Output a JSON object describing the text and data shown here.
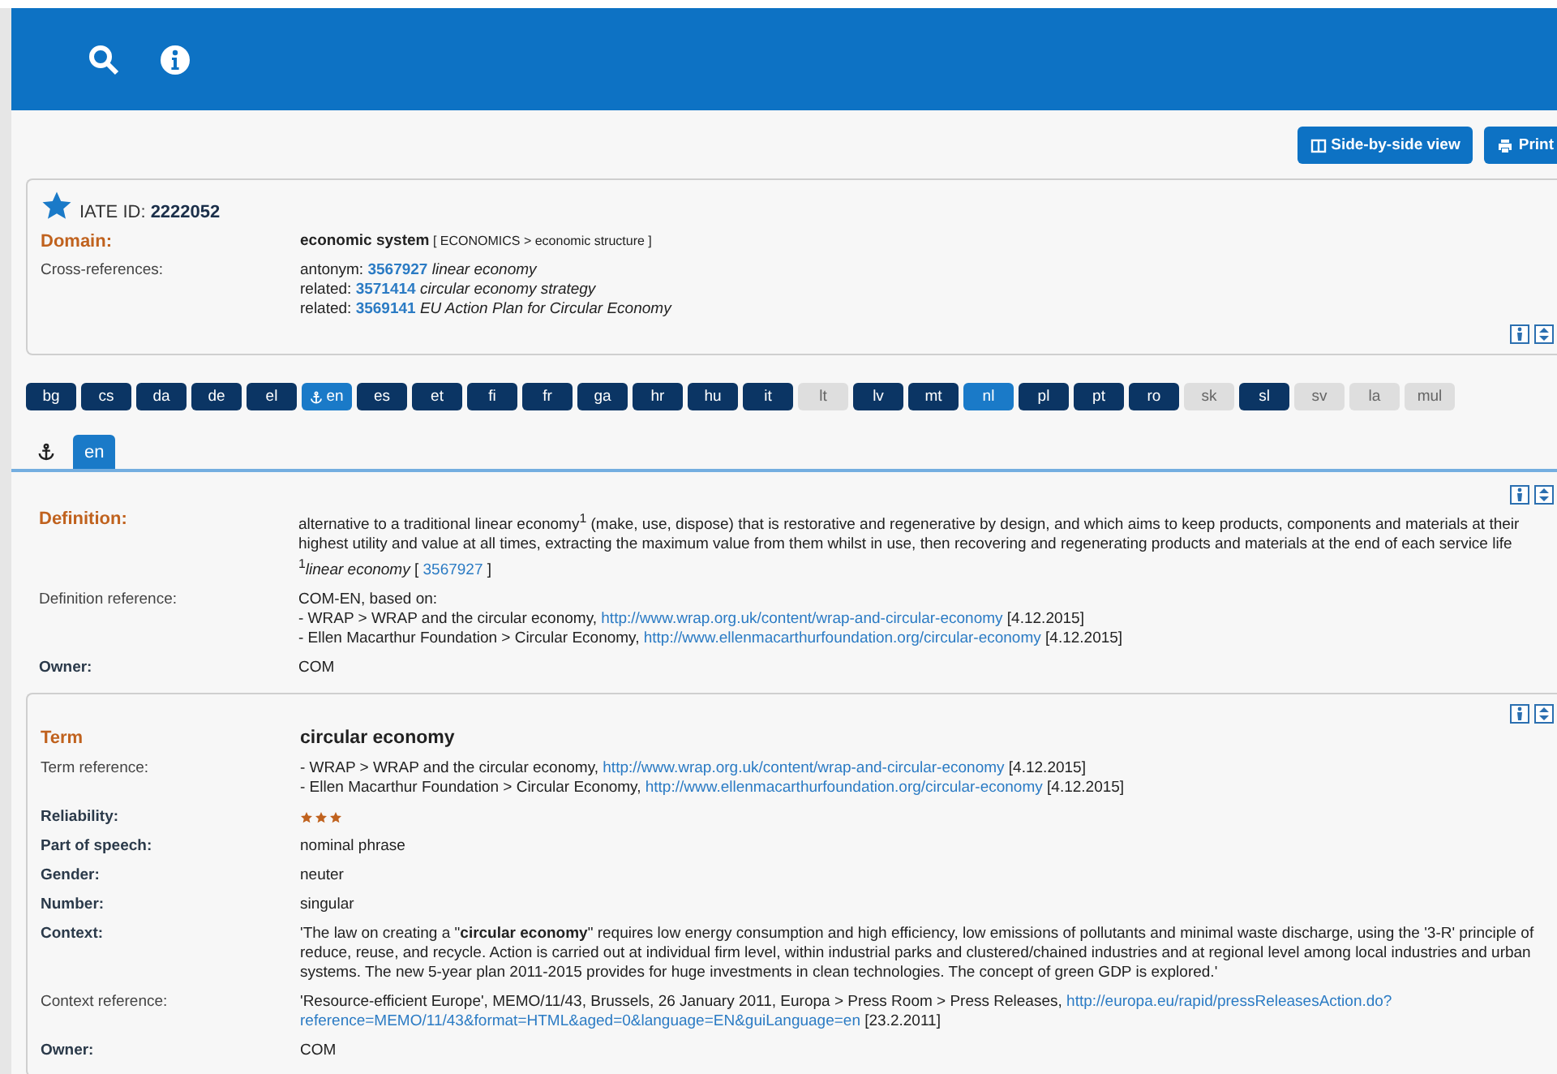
{
  "toolbar_buttons": [
    {
      "kind": "columns",
      "label": "Side-by-side view"
    },
    {
      "kind": "print",
      "label": "Print"
    }
  ],
  "entry_card": {
    "id_label": "IATE ID:",
    "id": "2222052",
    "rows": [
      {
        "label": "Domain:",
        "kind": "heading",
        "lines": [
          [
            {
              "kind": "text",
              "text": "**economic system**"
            },
            {
              "kind": "small",
              "text": " [ ECONOMICS > economic structure ]"
            }
          ]
        ]
      },
      {
        "label": "Cross-references:",
        "kind": "field",
        "lines": [
          [
            {
              "kind": "text",
              "text": "antonym: "
            },
            {
              "kind": "id_link",
              "text": "3567927"
            },
            {
              "kind": "text",
              "text": " *linear economy*"
            }
          ],
          [
            {
              "kind": "text",
              "text": "related: "
            },
            {
              "kind": "id_link",
              "text": "3571414"
            },
            {
              "kind": "text",
              "text": " *circular economy strategy*"
            }
          ],
          [
            {
              "kind": "text",
              "text": "related: "
            },
            {
              "kind": "id_link",
              "text": "3569141"
            },
            {
              "kind": "text",
              "text": " *EU Action Plan for Circular Economy*"
            }
          ]
        ]
      }
    ]
  },
  "languages": [
    {
      "code": "bg",
      "available": true,
      "selected": false,
      "anchor": false
    },
    {
      "code": "cs",
      "available": true,
      "selected": false,
      "anchor": false
    },
    {
      "code": "da",
      "available": true,
      "selected": false,
      "anchor": false
    },
    {
      "code": "de",
      "available": true,
      "selected": false,
      "anchor": false
    },
    {
      "code": "el",
      "available": true,
      "selected": false,
      "anchor": false
    },
    {
      "code": "en",
      "available": true,
      "selected": true,
      "anchor": true
    },
    {
      "code": "es",
      "available": true,
      "selected": false,
      "anchor": false
    },
    {
      "code": "et",
      "available": true,
      "selected": false,
      "anchor": false
    },
    {
      "code": "fi",
      "available": true,
      "selected": false,
      "anchor": false
    },
    {
      "code": "fr",
      "available": true,
      "selected": false,
      "anchor": false
    },
    {
      "code": "ga",
      "available": true,
      "selected": false,
      "anchor": false
    },
    {
      "code": "hr",
      "available": true,
      "selected": false,
      "anchor": false
    },
    {
      "code": "hu",
      "available": true,
      "selected": false,
      "anchor": false
    },
    {
      "code": "it",
      "available": true,
      "selected": false,
      "anchor": false
    },
    {
      "code": "lt",
      "available": false,
      "selected": false,
      "anchor": false
    },
    {
      "code": "lv",
      "available": true,
      "selected": false,
      "anchor": false
    },
    {
      "code": "mt",
      "available": true,
      "selected": false,
      "anchor": false
    },
    {
      "code": "nl",
      "available": true,
      "selected": true,
      "anchor": false
    },
    {
      "code": "pl",
      "available": true,
      "selected": false,
      "anchor": false
    },
    {
      "code": "pt",
      "available": true,
      "selected": false,
      "anchor": false
    },
    {
      "code": "ro",
      "available": true,
      "selected": false,
      "anchor": false
    },
    {
      "code": "sk",
      "available": false,
      "selected": false,
      "anchor": false
    },
    {
      "code": "sl",
      "available": true,
      "selected": false,
      "anchor": false
    },
    {
      "code": "sv",
      "available": false,
      "selected": false,
      "anchor": false
    },
    {
      "code": "la",
      "available": false,
      "selected": false,
      "anchor": false
    },
    {
      "code": "mul",
      "available": false,
      "selected": false,
      "anchor": false
    }
  ],
  "tabs": [
    {
      "kind": "anchor",
      "selected": false
    },
    {
      "kind": "label",
      "label": "en",
      "selected": true
    }
  ],
  "definition_block": {
    "rows": [
      {
        "label": "Definition:",
        "kind": "heading",
        "lines": [
          [
            {
              "kind": "text",
              "text": "alternative to a traditional linear economy$^{1}$ (make, use, dispose) that is restorative and regenerative by design, and which aims to keep products, components and materials at their highest utility and value at all times, extracting the maximum value from them whilst in use, then recovering and regenerating products and materials at the end of each service life"
            }
          ],
          [
            {
              "kind": "text",
              "text": "$^{1}$*linear economy* [ "
            },
            {
              "kind": "link",
              "text": "3567927"
            },
            {
              "kind": "text",
              "text": " ]"
            }
          ]
        ]
      },
      {
        "label": "Definition reference:",
        "kind": "field",
        "lines": [
          [
            {
              "kind": "text",
              "text": "COM-EN, based on:"
            }
          ],
          [
            {
              "kind": "text",
              "text": "- WRAP > WRAP and the circular economy, "
            },
            {
              "kind": "link",
              "text": "http://www.wrap.org.uk/content/wrap-and-circular-economy"
            },
            {
              "kind": "text",
              "text": " [4.12.2015]"
            }
          ],
          [
            {
              "kind": "text",
              "text": "- Ellen Macarthur Foundation > Circular Economy, "
            },
            {
              "kind": "link",
              "text": "http://www.ellenmacarthurfoundation.org/circular-economy"
            },
            {
              "kind": "text",
              "text": " [4.12.2015]"
            }
          ]
        ]
      },
      {
        "label": "Owner:",
        "kind": "bold",
        "lines": [
          [
            {
              "kind": "text",
              "text": "COM"
            }
          ]
        ]
      }
    ]
  },
  "term_card": {
    "rows": [
      {
        "label": "Term",
        "kind": "heading",
        "lines": [
          [
            {
              "kind": "term",
              "text": "circular economy"
            }
          ]
        ]
      },
      {
        "label": "Term reference:",
        "kind": "field",
        "lines": [
          [
            {
              "kind": "text",
              "text": "- WRAP > WRAP and the circular economy, "
            },
            {
              "kind": "link",
              "text": "http://www.wrap.org.uk/content/wrap-and-circular-economy"
            },
            {
              "kind": "text",
              "text": " [4.12.2015]"
            }
          ],
          [
            {
              "kind": "text",
              "text": "- Ellen Macarthur Foundation > Circular Economy, "
            },
            {
              "kind": "link",
              "text": "http://www.ellenmacarthurfoundation.org/circular-economy"
            },
            {
              "kind": "text",
              "text": " [4.12.2015]"
            }
          ]
        ]
      },
      {
        "label": "Reliability:",
        "kind": "bold",
        "stars": 3
      },
      {
        "label": "Part of speech:",
        "kind": "bold",
        "lines": [
          [
            {
              "kind": "text",
              "text": "nominal phrase"
            }
          ]
        ]
      },
      {
        "label": "Gender:",
        "kind": "bold",
        "lines": [
          [
            {
              "kind": "text",
              "text": "neuter"
            }
          ]
        ]
      },
      {
        "label": "Number:",
        "kind": "bold",
        "lines": [
          [
            {
              "kind": "text",
              "text": "singular"
            }
          ]
        ]
      },
      {
        "label": "Context:",
        "kind": "bold",
        "lines": [
          [
            {
              "kind": "text",
              "text": "'The law on creating a \"**circular economy**\" requires low energy consumption and high efficiency, low emissions of pollutants and minimal waste discharge, using the '3-R' principle of reduce, reuse, and recycle. Action is carried out at individual firm level, within industrial parks and clustered/chained industries and at regional level among local industries and urban systems. The new 5-year plan 2011-2015 provides for huge investments in clean technologies. The concept of green GDP is explored.'"
            }
          ]
        ]
      },
      {
        "label": "Context reference:",
        "kind": "field",
        "lines": [
          [
            {
              "kind": "text",
              "text": "'Resource-efficient Europe', MEMO/11/43, Brussels, 26 January 2011, Europa > Press Room > Press Releases, "
            },
            {
              "kind": "link",
              "text": "http://europa.eu/rapid/pressReleasesAction.do?"
            }
          ],
          [
            {
              "kind": "link",
              "text": "reference=MEMO/11/43&format=HTML&aged=0&language=EN&guiLanguage=en"
            },
            {
              "kind": "text",
              "text": " [23.2.2011]"
            }
          ]
        ]
      },
      {
        "label": "Owner:",
        "kind": "bold",
        "lines": [
          [
            {
              "kind": "text",
              "text": "COM"
            }
          ]
        ]
      }
    ]
  }
}
